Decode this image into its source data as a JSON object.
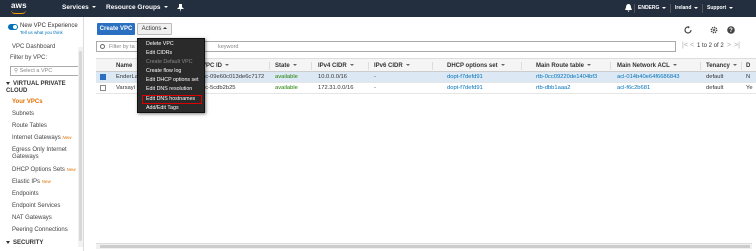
{
  "topnav": {
    "logo": "aws",
    "services": "Services",
    "resource_groups": "Resource Groups",
    "user": "ENDERG",
    "region": "Ireland",
    "support": "Support"
  },
  "sidebar": {
    "new_experience": "New VPC Experience",
    "tell_us": "Tell us what you think",
    "dashboard": "VPC Dashboard",
    "filter_label": "Filter by VPC:",
    "select_placeholder": "Select a VPC",
    "section_vpc": "VIRTUAL PRIVATE CLOUD",
    "items": [
      {
        "label": "Your VPCs"
      },
      {
        "label": "Subnets"
      },
      {
        "label": "Route Tables"
      },
      {
        "label": "Internet Gateways",
        "badge": "New"
      },
      {
        "label": "Egress Only Internet Gateways"
      },
      {
        "label": "DHCP Options Sets",
        "badge": "New"
      },
      {
        "label": "Elastic IPs",
        "badge": "New"
      },
      {
        "label": "Endpoints"
      },
      {
        "label": "Endpoint Services"
      },
      {
        "label": "NAT Gateways"
      },
      {
        "label": "Peering Connections"
      }
    ],
    "section_security": "SECURITY"
  },
  "toolbar": {
    "create_vpc": "Create VPC",
    "actions": "Actions"
  },
  "filter": {
    "placeholder_left": "Filter by ta",
    "placeholder_right": "keyword"
  },
  "pager": {
    "text": "1 to 2 of 2"
  },
  "table": {
    "headers": [
      "Name",
      "VPC ID",
      "State",
      "IPv4 CIDR",
      "IPv6 CIDR",
      "DHCP options set",
      "Main Route table",
      "Main Network ACL",
      "Tenancy",
      "D"
    ],
    "rows": [
      {
        "name": "EnderLa",
        "vpc_id": "pc-09e60c013de6c7172",
        "state": "available",
        "ipv4": "10.0.0.0/16",
        "ipv6": "-",
        "dhcp": "dopt-f7defd91",
        "route": "rtb-0cc09220de1404bf3",
        "acl": "acl-014b40e64f6686843",
        "tenancy": "default",
        "d": "N"
      },
      {
        "name": "Varsayi",
        "vpc_id": "pc-5cdb2b25",
        "state": "available",
        "ipv4": "172.31.0.0/16",
        "ipv6": "-",
        "dhcp": "dopt-f7defd91",
        "route": "rtb-dbb1aaa2",
        "acl": "acl-f6c2b681",
        "tenancy": "default",
        "d": "Ye"
      }
    ]
  },
  "menu": {
    "items": [
      {
        "label": "Delete VPC",
        "disabled": false
      },
      {
        "label": "Edit CIDRs",
        "disabled": false
      },
      {
        "label": "Create Default VPC",
        "disabled": true
      },
      {
        "label": "Create flow log",
        "disabled": false
      },
      {
        "label": "Edit DHCP options set",
        "disabled": false
      },
      {
        "label": "Edit DNS resolution",
        "disabled": false
      },
      {
        "label": "Edit DNS hostnames",
        "disabled": false
      },
      {
        "label": "Add/Edit Tags",
        "disabled": false
      }
    ]
  },
  "colors": {
    "nav_bg": "#232f3e",
    "primary": "#2b6fc1",
    "accent": "#e07000",
    "highlight": "#dd0000"
  },
  "icons": [
    "search-icon",
    "refresh-icon",
    "settings-icon",
    "help-icon",
    "bell-icon",
    "pin-icon",
    "filter-icon"
  ]
}
